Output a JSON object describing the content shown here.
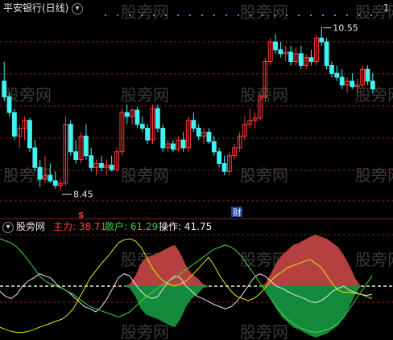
{
  "header": {
    "title": "平安银行(日线)",
    "corner_label": "1"
  },
  "watermark": "股旁网",
  "price_panel": {
    "high_label": "10.55",
    "low_label": "8.45",
    "finance_marker": "财",
    "signal_marker": "S"
  },
  "indicator_panel": {
    "name": "股旁网",
    "series": [
      {
        "name": "主力:",
        "value": "38.71",
        "color": "#ff4444"
      },
      {
        "name": "散户:",
        "value": "61.29",
        "color": "#44cc44"
      },
      {
        "name": "操作:",
        "value": "41.75",
        "color": "#f0f0f0"
      }
    ]
  },
  "colors": {
    "up_candle": "#ff3a3a",
    "down_candle": "#3ff3f3",
    "grid_red": "#8a1f1f",
    "dots": "#b04fff",
    "fill_red": "#b54040",
    "fill_green": "#168a3c",
    "line_white": "#e8e8e8",
    "line_yellow": "#e6e600",
    "line_green": "#3fdc3f"
  },
  "chart_data": [
    {
      "type": "candlestick",
      "title": "平安银行(日线)",
      "ylim": [
        8.2,
        10.7
      ],
      "annotations": [
        {
          "text": "10.55",
          "at_index": 62
        },
        {
          "text": "8.45",
          "at_index": 11
        }
      ],
      "candles": [
        [
          9.85,
          10.1,
          9.6,
          9.65
        ],
        [
          9.65,
          9.7,
          9.4,
          9.45
        ],
        [
          9.45,
          9.5,
          9.1,
          9.15
        ],
        [
          9.15,
          9.3,
          9.0,
          9.25
        ],
        [
          9.25,
          9.4,
          9.1,
          9.35
        ],
        [
          9.35,
          9.38,
          8.95,
          9.0
        ],
        [
          9.0,
          9.1,
          8.7,
          8.75
        ],
        [
          8.75,
          8.85,
          8.5,
          8.6
        ],
        [
          8.6,
          8.9,
          8.55,
          8.65
        ],
        [
          8.65,
          8.8,
          8.55,
          8.58
        ],
        [
          8.58,
          8.7,
          8.48,
          8.52
        ],
        [
          8.52,
          8.6,
          8.45,
          8.55
        ],
        [
          8.55,
          9.4,
          8.52,
          9.3
        ],
        [
          9.3,
          9.35,
          8.9,
          8.95
        ],
        [
          8.95,
          9.1,
          8.8,
          8.85
        ],
        [
          8.85,
          9.2,
          8.8,
          9.15
        ],
        [
          9.15,
          9.3,
          8.85,
          8.9
        ],
        [
          8.9,
          9.0,
          8.7,
          8.75
        ],
        [
          8.75,
          8.85,
          8.65,
          8.8
        ],
        [
          8.8,
          8.9,
          8.7,
          8.75
        ],
        [
          8.75,
          8.85,
          8.65,
          8.78
        ],
        [
          8.78,
          8.9,
          8.7,
          8.72
        ],
        [
          8.72,
          9.0,
          8.7,
          8.95
        ],
        [
          8.95,
          9.5,
          8.9,
          9.45
        ],
        [
          9.45,
          9.55,
          9.3,
          9.4
        ],
        [
          9.4,
          9.5,
          9.3,
          9.48
        ],
        [
          9.48,
          9.52,
          9.25,
          9.3
        ],
        [
          9.3,
          9.4,
          9.2,
          9.25
        ],
        [
          9.25,
          9.3,
          9.05,
          9.1
        ],
        [
          9.1,
          9.55,
          9.05,
          9.5
        ],
        [
          9.5,
          9.55,
          9.2,
          9.25
        ],
        [
          9.25,
          9.3,
          8.95,
          9.0
        ],
        [
          9.0,
          9.1,
          8.95,
          9.05
        ],
        [
          9.05,
          9.1,
          8.95,
          8.98
        ],
        [
          8.98,
          9.15,
          8.95,
          9.1
        ],
        [
          9.1,
          9.2,
          8.95,
          9.0
        ],
        [
          9.0,
          9.4,
          8.95,
          9.35
        ],
        [
          9.35,
          9.45,
          9.2,
          9.25
        ],
        [
          9.25,
          9.3,
          9.1,
          9.15
        ],
        [
          9.15,
          9.25,
          9.05,
          9.2
        ],
        [
          9.2,
          9.25,
          9.05,
          9.08
        ],
        [
          9.08,
          9.15,
          8.9,
          8.95
        ],
        [
          8.95,
          9.0,
          8.75,
          8.8
        ],
        [
          8.8,
          8.9,
          8.65,
          8.7
        ],
        [
          8.7,
          8.95,
          8.65,
          8.9
        ],
        [
          8.9,
          9.05,
          8.85,
          9.0
        ],
        [
          9.0,
          9.2,
          8.95,
          9.15
        ],
        [
          9.15,
          9.4,
          9.1,
          9.3
        ],
        [
          9.3,
          9.5,
          9.25,
          9.35
        ],
        [
          9.35,
          9.45,
          9.25,
          9.38
        ],
        [
          9.38,
          9.7,
          9.35,
          9.65
        ],
        [
          9.65,
          10.15,
          9.6,
          10.1
        ],
        [
          10.1,
          10.4,
          10.05,
          10.35
        ],
        [
          10.35,
          10.45,
          10.2,
          10.25
        ],
        [
          10.25,
          10.35,
          10.15,
          10.2
        ],
        [
          10.2,
          10.3,
          10.1,
          10.22
        ],
        [
          10.22,
          10.3,
          10.05,
          10.1
        ],
        [
          10.1,
          10.28,
          10.05,
          10.2
        ],
        [
          10.2,
          10.3,
          10.0,
          10.05
        ],
        [
          10.05,
          10.2,
          10.0,
          10.15
        ],
        [
          10.15,
          10.25,
          10.05,
          10.1
        ],
        [
          10.1,
          10.45,
          10.05,
          10.4
        ],
        [
          10.4,
          10.55,
          10.3,
          10.35
        ],
        [
          10.35,
          10.4,
          10.0,
          10.05
        ],
        [
          10.05,
          10.1,
          9.9,
          9.95
        ],
        [
          9.95,
          10.05,
          9.85,
          9.9
        ],
        [
          9.9,
          10.0,
          9.75,
          9.8
        ],
        [
          9.8,
          9.9,
          9.7,
          9.85
        ],
        [
          9.85,
          9.95,
          9.75,
          9.78
        ],
        [
          9.78,
          9.88,
          9.7,
          9.8
        ],
        [
          9.8,
          10.05,
          9.75,
          10.0
        ],
        [
          10.0,
          10.05,
          9.8,
          9.85
        ],
        [
          9.85,
          9.95,
          9.7,
          9.75
        ]
      ]
    },
    {
      "type": "area",
      "title": "股旁网",
      "ylim": [
        0,
        100
      ],
      "baseline": 50,
      "series": [
        {
          "name": "主力",
          "color": "#b54040",
          "values": [
            50,
            45,
            38,
            30,
            28,
            25,
            22,
            18,
            15,
            14,
            12,
            10,
            12,
            20,
            28,
            30,
            32,
            35,
            38,
            40,
            42,
            45,
            48,
            52,
            60,
            72,
            78,
            80,
            82,
            85,
            88,
            90,
            82,
            70,
            62,
            58,
            52,
            46,
            40,
            35,
            30,
            28,
            30,
            35,
            40,
            44,
            48,
            52,
            62,
            72,
            80,
            85,
            90,
            92,
            95,
            98,
            100,
            98,
            96,
            92,
            88,
            80,
            70,
            58,
            45,
            42,
            40
          ]
        },
        {
          "name": "散户",
          "color": "#168a3c",
          "values": [
            50,
            55,
            62,
            70,
            72,
            75,
            78,
            82,
            85,
            86,
            88,
            90,
            88,
            80,
            72,
            70,
            68,
            65,
            62,
            60,
            58,
            55,
            52,
            48,
            40,
            28,
            22,
            20,
            18,
            15,
            12,
            10,
            18,
            30,
            38,
            42,
            48,
            54,
            60,
            65,
            70,
            72,
            70,
            65,
            60,
            56,
            52,
            48,
            38,
            28,
            20,
            15,
            10,
            8,
            5,
            2,
            0,
            2,
            4,
            8,
            12,
            20,
            30,
            42,
            55,
            58,
            60
          ]
        },
        {
          "name": "操作",
          "color": "#e8e8e8",
          "values": [
            45,
            40,
            38,
            42,
            50,
            55,
            58,
            62,
            60,
            58,
            52,
            48,
            45,
            40,
            35,
            30,
            28,
            25,
            30,
            38,
            48,
            58,
            62,
            60,
            52,
            45,
            40,
            38,
            40,
            48,
            55,
            60,
            58,
            50,
            45,
            40,
            38,
            35,
            32,
            30,
            28,
            30,
            35,
            42,
            50,
            58,
            62,
            60,
            55,
            50,
            48,
            45,
            42,
            40,
            38,
            35,
            34,
            36,
            40,
            45,
            48,
            50,
            46,
            44,
            42,
            41,
            42
          ]
        },
        {
          "name": "yellow",
          "color": "#e6e600",
          "values": [
            10,
            8,
            6,
            5,
            5,
            6,
            8,
            10,
            12,
            14,
            16,
            18,
            22,
            28,
            38,
            48,
            58,
            65,
            72,
            78,
            85,
            92,
            95,
            96,
            94,
            88,
            78,
            68,
            60,
            55,
            52,
            50,
            52,
            55,
            60,
            66,
            72,
            78,
            70,
            60,
            52,
            45,
            40,
            38,
            36,
            38,
            42,
            48,
            55,
            60,
            64,
            68,
            70,
            72,
            74,
            76,
            72,
            68,
            60,
            52,
            46,
            44,
            44,
            43,
            42,
            40,
            38
          ]
        },
        {
          "name": "green",
          "color": "#3fdc3f",
          "values": [
            96,
            94,
            92,
            88,
            82,
            75,
            68,
            60,
            55,
            52,
            50,
            48,
            45,
            42,
            38,
            34,
            30,
            28,
            26,
            24,
            22,
            20,
            22,
            25,
            30,
            35,
            40,
            44,
            48,
            52,
            55,
            58,
            62,
            66,
            70,
            74,
            78,
            82,
            86,
            88,
            90,
            88,
            84,
            78,
            70,
            62,
            54,
            46,
            38,
            30,
            24,
            18,
            14,
            10,
            8,
            6,
            5,
            6,
            8,
            10,
            14,
            20,
            28,
            36,
            44,
            52,
            60
          ]
        }
      ]
    }
  ]
}
